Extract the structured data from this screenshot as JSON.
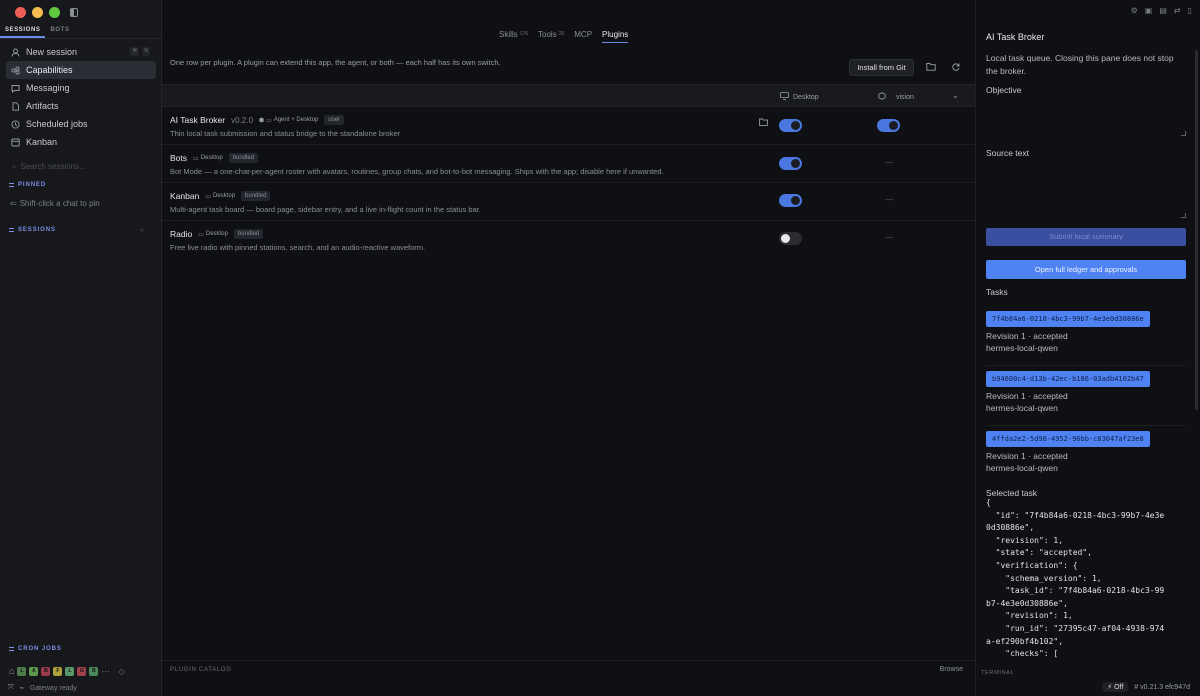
{
  "sidebar": {
    "tabs": [
      "SESSIONS",
      "BOTS"
    ],
    "nav": [
      {
        "label": "New session",
        "icon": "person-icon",
        "kbd": [
          "⌘",
          "N"
        ]
      },
      {
        "label": "Capabilities",
        "icon": "capabilities-icon"
      },
      {
        "label": "Messaging",
        "icon": "chat-icon"
      },
      {
        "label": "Artifacts",
        "icon": "file-icon"
      },
      {
        "label": "Scheduled jobs",
        "icon": "clock-icon"
      },
      {
        "label": "Kanban",
        "icon": "board-icon"
      }
    ],
    "search_placeholder": "Search sessions...",
    "pinned_label": "PINNED",
    "pin_hint": "Shift-click a chat to pin",
    "sessions_label": "SESSIONS",
    "cron_label": "CRON JOBS",
    "status": "Gateway ready",
    "bottom_icons": [
      "L",
      "A",
      "B",
      "F",
      "L",
      "G",
      "B"
    ]
  },
  "main": {
    "tabs": [
      {
        "label": "Skills",
        "count": "176"
      },
      {
        "label": "Tools",
        "count": "26"
      },
      {
        "label": "MCP",
        "count": ""
      },
      {
        "label": "Plugins",
        "count": ""
      }
    ],
    "description": "One row per plugin. A plugin can extend this app, the agent, or both — each half has its own switch.",
    "install_label": "Install from Git",
    "col_desktop": "Desktop",
    "col_vision": "vision",
    "rows": [
      {
        "name": "AI Task Broker",
        "version": "v0.2.0",
        "scope": "Agent + Desktop",
        "badge": "user",
        "desc": "Thin local task submission and status bridge to the standalone broker",
        "desktop_on": true,
        "vision": "toggle-on"
      },
      {
        "name": "Bots",
        "version": "",
        "scope": "Desktop",
        "badge": "bundled",
        "desc": "Bot Mode — a one-chat-per-agent roster with avatars, routines, group chats, and bot-to-bot messaging. Ships with the app; disable here if unwanted.",
        "desktop_on": true,
        "vision": "—"
      },
      {
        "name": "Kanban",
        "version": "",
        "scope": "Desktop",
        "badge": "bundled",
        "desc": "Multi-agent task board — board page, sidebar entry, and a live in-flight count in the status bar.",
        "desktop_on": true,
        "vision": "—"
      },
      {
        "name": "Radio",
        "version": "",
        "scope": "Desktop",
        "badge": "bundled",
        "desc": "Free live radio with pinned stations, search, and an audio-reactive waveform.",
        "desktop_on": false,
        "vision": "—"
      }
    ],
    "footer_label": "PLUGIN CATALOG",
    "browse_label": "Browse"
  },
  "right": {
    "title": "AI Task Broker",
    "subtitle": "Local task queue. Closing this pane does not stop the broker.",
    "objective_label": "Objective",
    "source_label": "Source text",
    "submit_label": "Submit local summary",
    "ledger_label": "Open full ledger and approvals",
    "tasks_label": "Tasks",
    "tasks": [
      {
        "id": "7f4b84a6-0218-4bc3-99b7-4e3e0d30886e",
        "revision": "Revision 1 · accepted",
        "model": "hermes-local-qwen"
      },
      {
        "id": "b94600c4-d13b-42ec-b186-03adb4102b47",
        "revision": "Revision 1 · accepted",
        "model": "hermes-local-qwen"
      },
      {
        "id": "4ffda2e2-5d98-4952-96bb-c83047af23e8",
        "revision": "Revision 1 · accepted",
        "model": "hermes-local-qwen"
      }
    ],
    "selected_label": "Selected task",
    "selected_json": "{\n  \"id\": \"7f4b84a6-0218-4bc3-99b7-4e3e\n0d30886e\",\n  \"revision\": 1,\n  \"state\": \"accepted\",\n  \"verification\": {\n    \"schema_version\": 1,\n    \"task_id\": \"7f4b84a6-0218-4bc3-99\nb7-4e3e0d30886e\",\n    \"revision\": 1,\n    \"run_id\": \"27395c47-af04-4938-974\na-ef290bf4b102\",\n    \"checks\": [",
    "terminal_label": "TERMINAL",
    "status_off": "Off",
    "version": "v0.21.3 efc947d"
  },
  "colors": {
    "accent": "#4f82f2",
    "section": "#7d8fe6"
  }
}
